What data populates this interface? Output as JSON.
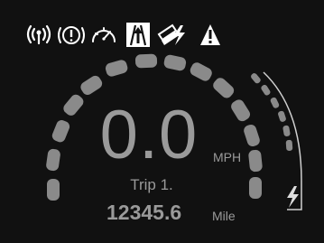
{
  "status_icons": [
    {
      "name": "wireless-signal-icon"
    },
    {
      "name": "brake-warning-icon"
    },
    {
      "name": "speedometer-icon"
    },
    {
      "name": "lane-assist-icon"
    },
    {
      "name": "battery-charging-icon"
    },
    {
      "name": "warning-triangle-icon"
    }
  ],
  "speed": {
    "value": "0.0",
    "unit": "MPH"
  },
  "trip": {
    "label": "Trip 1.",
    "distance": "12345.6",
    "unit": "Mile"
  },
  "colors": {
    "background": "#111111",
    "text": "#9a9a9a",
    "icon": "#ffffff",
    "segment": "#8a8a8a"
  }
}
